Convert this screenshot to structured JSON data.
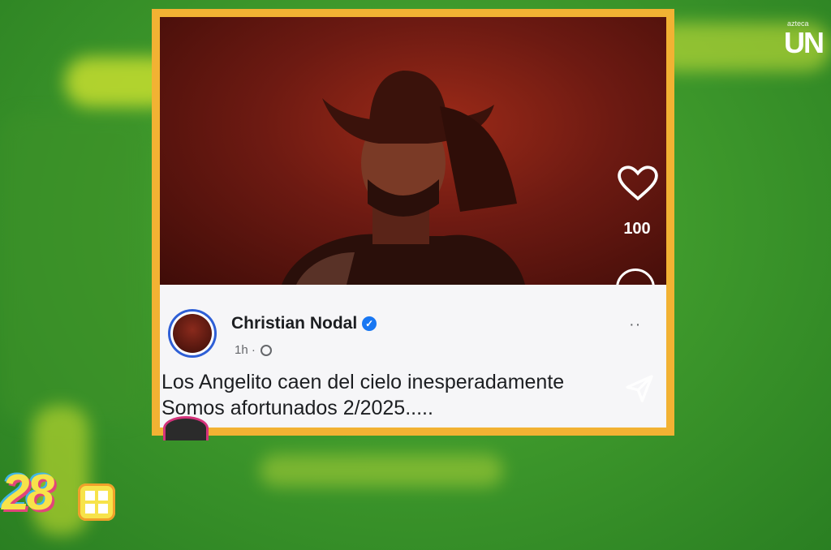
{
  "channel": {
    "small_label": "azteca",
    "big_label": "UN"
  },
  "post": {
    "author": "Christian Nodal",
    "time": "1h ·",
    "text_line1": "Los Angelito caen del cielo inesperadamente",
    "text_line2": "Somos afortunados 2/2025.....",
    "likes": "100",
    "more": "··"
  },
  "show": {
    "number": "28"
  },
  "icons": {
    "like": "heart-icon",
    "comment": "comment-icon",
    "share": "share-icon",
    "verified": "verified-badge-icon",
    "privacy": "globe-icon"
  },
  "colors": {
    "frame": "#f2b233",
    "background": "#3f9a2c",
    "verified": "#1877f2"
  }
}
